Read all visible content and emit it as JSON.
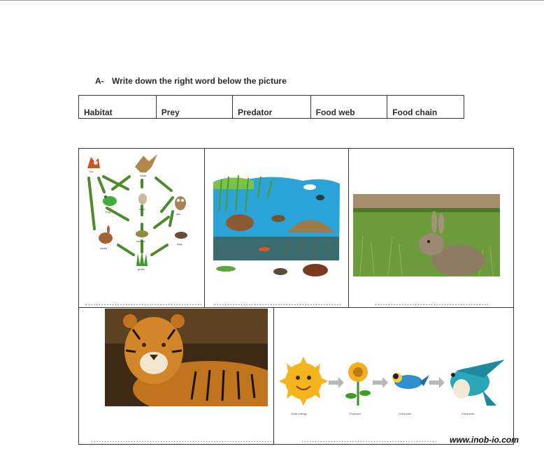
{
  "instruction": {
    "letter": "A-",
    "text": "Write down the right word below the picture"
  },
  "word_bank": [
    "Habitat",
    "Prey",
    "Predator",
    "Food web",
    "Food chain"
  ],
  "food_web": {
    "labels": [
      "fox",
      "hawk",
      "frog",
      "mice",
      "owl",
      "rabbit",
      "insects",
      "slug",
      "grass"
    ]
  },
  "food_chain": {
    "labels": [
      "Solar energy",
      "Producer",
      "Consumer",
      "Consumer"
    ]
  },
  "answer_line": "............................................................................................",
  "watermark": "www.inob-io.com"
}
